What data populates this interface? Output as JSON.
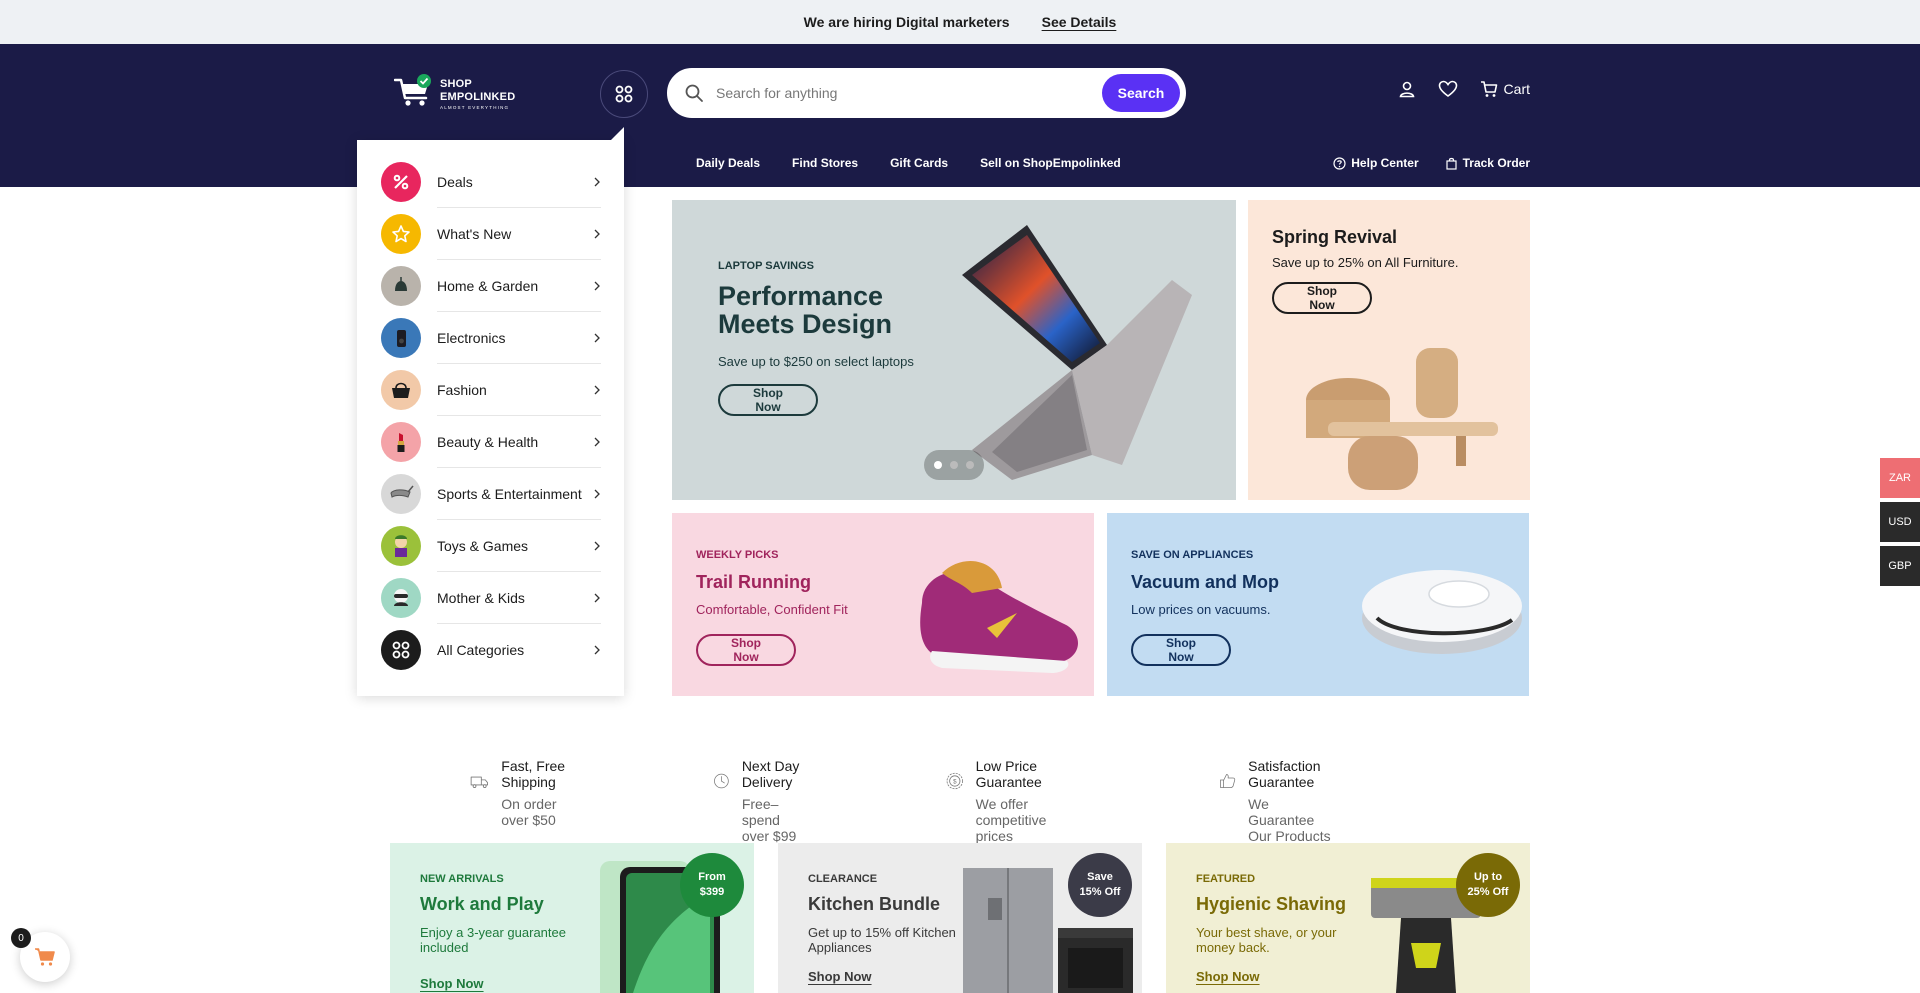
{
  "announcement": {
    "message": "We are hiring Digital marketers",
    "link_label": "See Details"
  },
  "logo": {
    "brand_line1": "SHOP",
    "brand_line2": "EMPOLINKED",
    "tagline": "ALMOST EVERYTHING"
  },
  "search": {
    "placeholder": "Search for anything",
    "button_label": "Search"
  },
  "header_actions": {
    "cart_label": "Cart"
  },
  "subnav": {
    "items": [
      "Daily Deals",
      "Find Stores",
      "Gift Cards",
      "Sell on ShopEmpolinked"
    ],
    "help_label": "Help Center",
    "track_label": "Track Order"
  },
  "categories": [
    {
      "label": "Deals",
      "icon": "percent-icon",
      "color": "#e8265e"
    },
    {
      "label": "What's New",
      "icon": "star-icon",
      "color": "#f6b800"
    },
    {
      "label": "Home & Garden",
      "icon": "lamp-icon",
      "color": "#b9b3ab"
    },
    {
      "label": "Electronics",
      "icon": "speaker-icon",
      "color": "#3a78b8"
    },
    {
      "label": "Fashion",
      "icon": "handbag-icon",
      "color": "#f2c9a8"
    },
    {
      "label": "Beauty & Health",
      "icon": "lipstick-icon",
      "color": "#f4a3a8"
    },
    {
      "label": "Sports & Entertainment",
      "icon": "golf-club-icon",
      "color": "#d8d8d8"
    },
    {
      "label": "Toys & Games",
      "icon": "toy-figure-icon",
      "color": "#9bc13a"
    },
    {
      "label": "Mother & Kids",
      "icon": "kid-icon",
      "color": "#9fd8c4"
    },
    {
      "label": "All Categories",
      "icon": "grid-icon",
      "color": "#1c1c1c"
    }
  ],
  "hero": {
    "eyebrow": "LAPTOP SAVINGS",
    "title": "Performance Meets Design",
    "subtitle": "Save up to $250 on select laptops",
    "button_label": "Shop Now",
    "active_slide": 1,
    "slides": 3
  },
  "side_banner": {
    "title": "Spring Revival",
    "subtitle": "Save up to 25% on All Furniture.",
    "button_label": "Shop Now"
  },
  "promos": [
    {
      "eyebrow": "WEEKLY PICKS",
      "title": "Trail Running",
      "subtitle": "Comfortable, Confident Fit",
      "button_label": "Shop Now"
    },
    {
      "eyebrow": "SAVE ON APPLIANCES",
      "title": "Vacuum and Mop",
      "subtitle": "Low prices on vacuums.",
      "button_label": "Shop Now"
    }
  ],
  "currencies": [
    {
      "code": "ZAR",
      "color": "#ee6e73"
    },
    {
      "code": "USD",
      "color": "#2a2a2a"
    },
    {
      "code": "GBP",
      "color": "#2a2a2a"
    }
  ],
  "features": [
    {
      "title": "Fast, Free Shipping",
      "subtitle": "On order over $50",
      "icon": "truck-icon"
    },
    {
      "title": "Next Day Delivery",
      "subtitle": "Free– spend over $99",
      "icon": "clock-icon"
    },
    {
      "title": "Low Price Guarantee",
      "subtitle": "We offer competitive prices",
      "icon": "dollar-badge-icon"
    },
    {
      "title": "Satisfaction Guarantee",
      "subtitle": "We Guarantee Our Products",
      "icon": "thumbs-up-icon"
    }
  ],
  "cards": [
    {
      "eyebrow": "NEW ARRIVALS",
      "title": "Work and Play",
      "subtitle": "Enjoy a 3-year guarantee included",
      "link": "Shop Now",
      "badge_line1": "From",
      "badge_line2": "$399",
      "badge_color": "#1e8a3c"
    },
    {
      "eyebrow": "CLEARANCE",
      "title": "Kitchen Bundle",
      "subtitle": "Get up to 15% off Kitchen Appliances",
      "link": "Shop Now",
      "badge_line1": "Save",
      "badge_line2": "15% Off",
      "badge_color": "#3b3b48"
    },
    {
      "eyebrow": "FEATURED",
      "title": "Hygienic Shaving",
      "subtitle": "Your best shave, or your money back.",
      "link": "Shop Now",
      "badge_line1": "Up to",
      "badge_line2": "25% Off",
      "badge_color": "#7a6a06"
    }
  ],
  "floating_cart": {
    "count": "0"
  }
}
